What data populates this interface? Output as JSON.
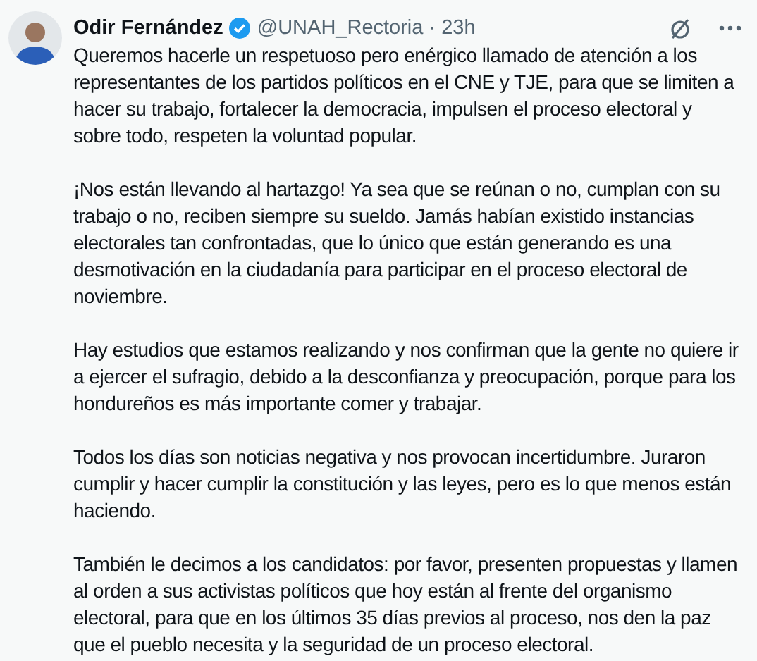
{
  "tweet": {
    "author": "Odir Fernández",
    "verified": true,
    "handle": "@UNAH_Rectoria",
    "separator": "·",
    "time": "23h",
    "paragraphs": [
      "Queremos hacerle un respetuoso pero enérgico llamado de atención a los representantes de los partidos políticos en el CNE y TJE, para que se limiten a hacer su trabajo, fortalecer la democracia, impulsen el proceso electoral y sobre todo, respeten la voluntad popular.",
      "¡Nos están llevando al hartazgo! Ya sea que se reúnan o no, cumplan con su trabajo o no, reciben siempre su sueldo. Jamás habían existido instancias electorales tan confrontadas, que lo único que están generando es una desmotivación en la ciudadanía para participar en el proceso electoral de noviembre.",
      "Hay estudios que estamos realizando y nos confirman que la gente no quiere ir a ejercer el sufragio, debido a la desconfianza y preocupación, porque para los hondureños es más importante comer y trabajar.",
      "Todos los días son noticias negativa y nos provocan incertidumbre. Juraron cumplir y hacer cumplir la constitución y las leyes, pero es lo que menos están haciendo.",
      "También le decimos a los candidatos: por favor, presenten propuestas y llamen al orden a sus activistas políticos que hoy están al frente del organismo electoral, para que en los últimos 35 días previos al proceso, nos den la paz que el pueblo necesita y la seguridad de un proceso electoral."
    ]
  }
}
